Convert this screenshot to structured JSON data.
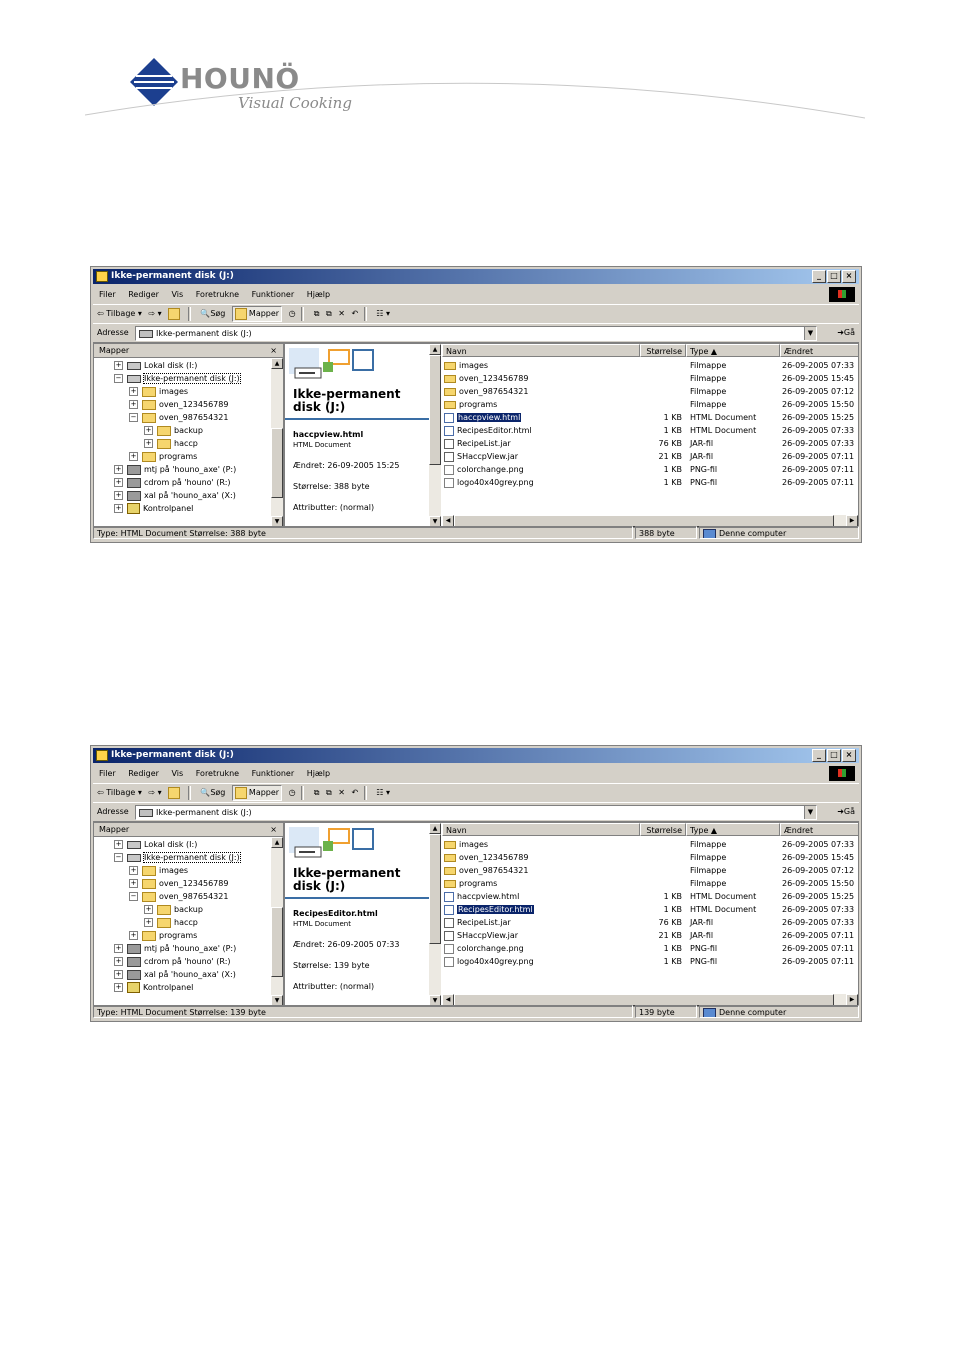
{
  "logo": {
    "name": "HOUNÖ",
    "tagline": "Visual Cooking"
  },
  "windows": [
    {
      "title": "Ikke-permanent disk (J:)",
      "menu": [
        "Filer",
        "Rediger",
        "Vis",
        "Foretrukne",
        "Funktioner",
        "Hjælp"
      ],
      "toolbar": {
        "back": "Tilbage",
        "search": "Søg",
        "folders": "Mapper"
      },
      "address": {
        "label": "Adresse",
        "value": "Ikke-permanent disk (J:)",
        "go": "Gå"
      },
      "folders_header": "Mapper",
      "tree": [
        {
          "label": "Lokal disk (I:)",
          "icon": "disk"
        },
        {
          "label": "Ikke-permanent disk (J:)",
          "icon": "disk"
        },
        {
          "label": "images",
          "icon": "folder"
        },
        {
          "label": "oven_123456789",
          "icon": "folder"
        },
        {
          "label": "oven_987654321",
          "icon": "folder"
        },
        {
          "label": "backup",
          "icon": "folder"
        },
        {
          "label": "haccp",
          "icon": "folder"
        },
        {
          "label": "programs",
          "icon": "folder"
        },
        {
          "label": "mtj på 'houno_axe' (P:)",
          "icon": "network"
        },
        {
          "label": "cdrom på 'houno' (R:)",
          "icon": "network"
        },
        {
          "label": "xal på 'houno_axa' (X:)",
          "icon": "network"
        },
        {
          "label": "Kontrolpanel",
          "icon": "control-panel"
        }
      ],
      "webview": {
        "title_line1": "Ikke-permanent",
        "title_line2": "disk (J:)",
        "file_name": "haccpview.html",
        "file_type": "HTML Document",
        "modified": "Ændret: 26-09-2005 15:25",
        "size": "Størrelse: 388 byte",
        "attributes": "Attributter: (normal)"
      },
      "columns": [
        "Navn",
        "Størrelse",
        "Type",
        "Ændret"
      ],
      "files": [
        {
          "name": "images",
          "size": "",
          "type": "Filmappe",
          "date": "26-09-2005 07:33",
          "icon": "folder"
        },
        {
          "name": "oven_123456789",
          "size": "",
          "type": "Filmappe",
          "date": "26-09-2005 15:45",
          "icon": "folder"
        },
        {
          "name": "oven_987654321",
          "size": "",
          "type": "Filmappe",
          "date": "26-09-2005 07:12",
          "icon": "folder"
        },
        {
          "name": "programs",
          "size": "",
          "type": "Filmappe",
          "date": "26-09-2005 15:50",
          "icon": "folder"
        },
        {
          "name": "haccpview.html",
          "size": "1 KB",
          "type": "HTML Document",
          "date": "26-09-2005 15:25",
          "icon": "html"
        },
        {
          "name": "RecipesEditor.html",
          "size": "1 KB",
          "type": "HTML Document",
          "date": "26-09-2005 07:33",
          "icon": "html"
        },
        {
          "name": "RecipeList.jar",
          "size": "76 KB",
          "type": "JAR-fil",
          "date": "26-09-2005 07:33",
          "icon": "jar"
        },
        {
          "name": "SHaccpView.jar",
          "size": "21 KB",
          "type": "JAR-fil",
          "date": "26-09-2005 07:11",
          "icon": "jar"
        },
        {
          "name": "colorchange.png",
          "size": "1 KB",
          "type": "PNG-fil",
          "date": "26-09-2005 07:11",
          "icon": "png"
        },
        {
          "name": "logo40x40grey.png",
          "size": "1 KB",
          "type": "PNG-fil",
          "date": "26-09-2005 07:11",
          "icon": "png"
        }
      ],
      "selected_index": 4,
      "status": {
        "info": "Type: HTML Document Størrelse: 388 byte",
        "size": "388 byte",
        "zone": "Denne computer"
      }
    },
    {
      "title": "Ikke-permanent disk (J:)",
      "menu": [
        "Filer",
        "Rediger",
        "Vis",
        "Foretrukne",
        "Funktioner",
        "Hjælp"
      ],
      "toolbar": {
        "back": "Tilbage",
        "search": "Søg",
        "folders": "Mapper"
      },
      "address": {
        "label": "Adresse",
        "value": "Ikke-permanent disk (J:)",
        "go": "Gå"
      },
      "folders_header": "Mapper",
      "tree": [
        {
          "label": "Lokal disk (I:)",
          "icon": "disk"
        },
        {
          "label": "Ikke-permanent disk (J:)",
          "icon": "disk"
        },
        {
          "label": "images",
          "icon": "folder"
        },
        {
          "label": "oven_123456789",
          "icon": "folder"
        },
        {
          "label": "oven_987654321",
          "icon": "folder"
        },
        {
          "label": "backup",
          "icon": "folder"
        },
        {
          "label": "haccp",
          "icon": "folder"
        },
        {
          "label": "programs",
          "icon": "folder"
        },
        {
          "label": "mtj på 'houno_axe' (P:)",
          "icon": "network"
        },
        {
          "label": "cdrom på 'houno' (R:)",
          "icon": "network"
        },
        {
          "label": "xal på 'houno_axa' (X:)",
          "icon": "network"
        },
        {
          "label": "Kontrolpanel",
          "icon": "control-panel"
        }
      ],
      "webview": {
        "title_line1": "Ikke-permanent",
        "title_line2": "disk (J:)",
        "file_name": "RecipesEditor.html",
        "file_type": "HTML Document",
        "modified": "Ændret: 26-09-2005 07:33",
        "size": "Størrelse: 139 byte",
        "attributes": "Attributter: (normal)"
      },
      "columns": [
        "Navn",
        "Størrelse",
        "Type",
        "Ændret"
      ],
      "files": [
        {
          "name": "images",
          "size": "",
          "type": "Filmappe",
          "date": "26-09-2005 07:33",
          "icon": "folder"
        },
        {
          "name": "oven_123456789",
          "size": "",
          "type": "Filmappe",
          "date": "26-09-2005 15:45",
          "icon": "folder"
        },
        {
          "name": "oven_987654321",
          "size": "",
          "type": "Filmappe",
          "date": "26-09-2005 07:12",
          "icon": "folder"
        },
        {
          "name": "programs",
          "size": "",
          "type": "Filmappe",
          "date": "26-09-2005 15:50",
          "icon": "folder"
        },
        {
          "name": "haccpview.html",
          "size": "1 KB",
          "type": "HTML Document",
          "date": "26-09-2005 15:25",
          "icon": "html"
        },
        {
          "name": "RecipesEditor.html",
          "size": "1 KB",
          "type": "HTML Document",
          "date": "26-09-2005 07:33",
          "icon": "html"
        },
        {
          "name": "RecipeList.jar",
          "size": "76 KB",
          "type": "JAR-fil",
          "date": "26-09-2005 07:33",
          "icon": "jar"
        },
        {
          "name": "SHaccpView.jar",
          "size": "21 KB",
          "type": "JAR-fil",
          "date": "26-09-2005 07:11",
          "icon": "jar"
        },
        {
          "name": "colorchange.png",
          "size": "1 KB",
          "type": "PNG-fil",
          "date": "26-09-2005 07:11",
          "icon": "png"
        },
        {
          "name": "logo40x40grey.png",
          "size": "1 KB",
          "type": "PNG-fil",
          "date": "26-09-2005 07:11",
          "icon": "png"
        }
      ],
      "selected_index": 5,
      "status": {
        "info": "Type: HTML Document Størrelse: 139 byte",
        "size": "139 byte",
        "zone": "Denne computer"
      }
    }
  ]
}
